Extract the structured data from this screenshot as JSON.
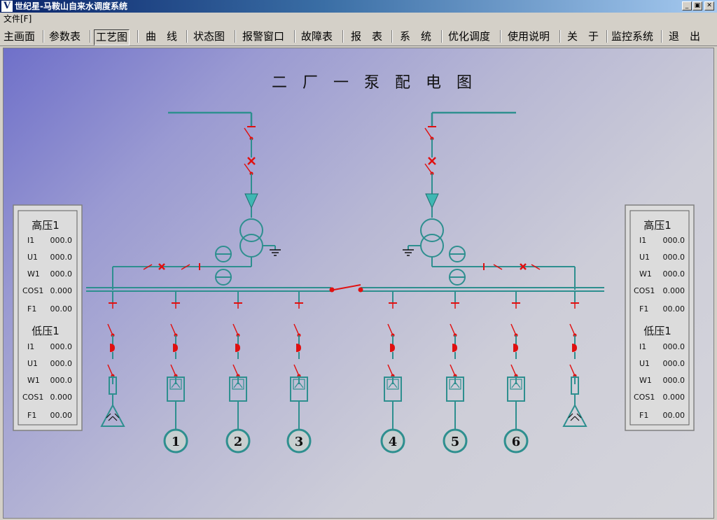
{
  "window": {
    "icon_letter": "V",
    "title": "世纪星-马鞍山自来水调度系统",
    "minimize_glyph": "_",
    "maximize_glyph": "▣",
    "close_glyph": "✕"
  },
  "menubar": {
    "file_label": "文件[F]"
  },
  "toolbar": {
    "items": [
      "主画面",
      "参数表",
      "工艺图",
      "曲　线",
      "状态图",
      "报警窗口",
      "故障表",
      "报　表",
      "系　统",
      "优化调度",
      "使用说明",
      "关　于",
      "监控系统",
      "退　出"
    ],
    "active_index": 2
  },
  "diagram": {
    "title": "二　厂　一　泵　配　电　图",
    "pump_labels": [
      "1",
      "2",
      "3",
      "4",
      "5",
      "6"
    ]
  },
  "panels": [
    {
      "hv_title": "高压1",
      "hv_rows": [
        [
          "I1",
          "000.0"
        ],
        [
          "U1",
          "000.0"
        ],
        [
          "W1",
          "000.0"
        ],
        [
          "COS1",
          "0.000"
        ],
        [
          "F1",
          "00.00"
        ]
      ],
      "lv_title": "低压1",
      "lv_rows": [
        [
          "I1",
          "000.0"
        ],
        [
          "U1",
          "000.0"
        ],
        [
          "W1",
          "000.0"
        ],
        [
          "COS1",
          "0.000"
        ],
        [
          "F1",
          "00.00"
        ]
      ]
    },
    {
      "hv_title": "高压1",
      "hv_rows": [
        [
          "I1",
          "000.0"
        ],
        [
          "U1",
          "000.0"
        ],
        [
          "W1",
          "000.0"
        ],
        [
          "COS1",
          "0.000"
        ],
        [
          "F1",
          "00.00"
        ]
      ],
      "lv_title": "低压1",
      "lv_rows": [
        [
          "I1",
          "000.0"
        ],
        [
          "U1",
          "000.0"
        ],
        [
          "W1",
          "000.0"
        ],
        [
          "COS1",
          "0.000"
        ],
        [
          "F1",
          "00.00"
        ]
      ]
    }
  ],
  "colors": {
    "line": "#2e8f8f",
    "teal_fill": "#3fb7b3",
    "breaker_red": "#e01010",
    "panel_bg": "#dcdcdc"
  }
}
